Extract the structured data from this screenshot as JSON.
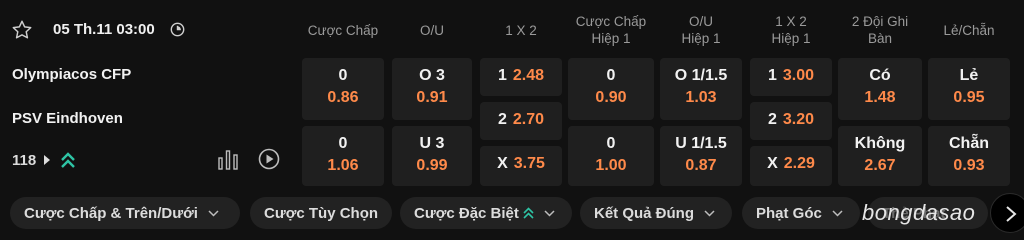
{
  "match": {
    "datetime": "05 Th.11 03:00",
    "home_team": "Olympiacos CFP",
    "away_team": "PSV Eindhoven",
    "markets_count": "118"
  },
  "columns": [
    {
      "line1": "Cược Chấp",
      "line2": ""
    },
    {
      "line1": "O/U",
      "line2": ""
    },
    {
      "line1": "1 X 2",
      "line2": ""
    },
    {
      "line1": "Cược Chấp",
      "line2": "Hiệp 1"
    },
    {
      "line1": "O/U",
      "line2": "Hiệp 1"
    },
    {
      "line1": "1 X 2",
      "line2": "Hiệp 1"
    },
    {
      "line1": "2 Đội Ghi",
      "line2": "Bàn"
    },
    {
      "line1": "Lẻ/Chẵn",
      "line2": ""
    }
  ],
  "odds": {
    "handicap": {
      "home": {
        "line": "0",
        "odd": "0.86"
      },
      "away": {
        "line": "0",
        "odd": "1.06"
      }
    },
    "over_under": {
      "over": {
        "line": "O 3",
        "odd": "0.91"
      },
      "under": {
        "line": "U 3",
        "odd": "0.99"
      }
    },
    "x12": {
      "home": {
        "label": "1",
        "odd": "2.48"
      },
      "draw": {
        "label": "2",
        "odd": "2.70"
      },
      "away": {
        "label": "X",
        "odd": "3.75"
      }
    },
    "handicap_h1": {
      "home": {
        "line": "0",
        "odd": "0.90"
      },
      "away": {
        "line": "0",
        "odd": "1.00"
      }
    },
    "over_under_h1": {
      "over": {
        "line": "O 1/1.5",
        "odd": "1.03"
      },
      "under": {
        "line": "U 1/1.5",
        "odd": "0.87"
      }
    },
    "x12_h1": {
      "home": {
        "label": "1",
        "odd": "3.00"
      },
      "draw": {
        "label": "2",
        "odd": "3.20"
      },
      "away": {
        "label": "X",
        "odd": "2.29"
      }
    },
    "btts": {
      "yes": {
        "label": "Có",
        "odd": "1.48"
      },
      "no": {
        "label": "Không",
        "odd": "2.67"
      }
    },
    "odd_even": {
      "odd": {
        "label": "Lẻ",
        "odd": "0.95"
      },
      "even": {
        "label": "Chẵn",
        "odd": "0.93"
      }
    }
  },
  "tabs": [
    {
      "label": "Cược Chấp & Trên/Dưới"
    },
    {
      "label": "Cược Tùy Chọn"
    },
    {
      "label": "Cược Đặc Biệt"
    },
    {
      "label": "Kết Quả Đúng"
    },
    {
      "label": "Phạt Góc"
    },
    {
      "label": "Thẻ Phạt"
    }
  ],
  "watermark": "bongdasao",
  "colors": {
    "background": "#111111",
    "cell": "#1f1f1f",
    "odd_value": "#ff8a4a",
    "accent": "#2ec4a5"
  },
  "icons": {
    "favorite": "star-icon",
    "live_clock": "clock-icon",
    "stats": "bar-chart-icon",
    "video": "play-icon",
    "expand": "chevron-down-icon",
    "boost": "double-chevron-up-icon",
    "next": "chevron-right-icon"
  }
}
